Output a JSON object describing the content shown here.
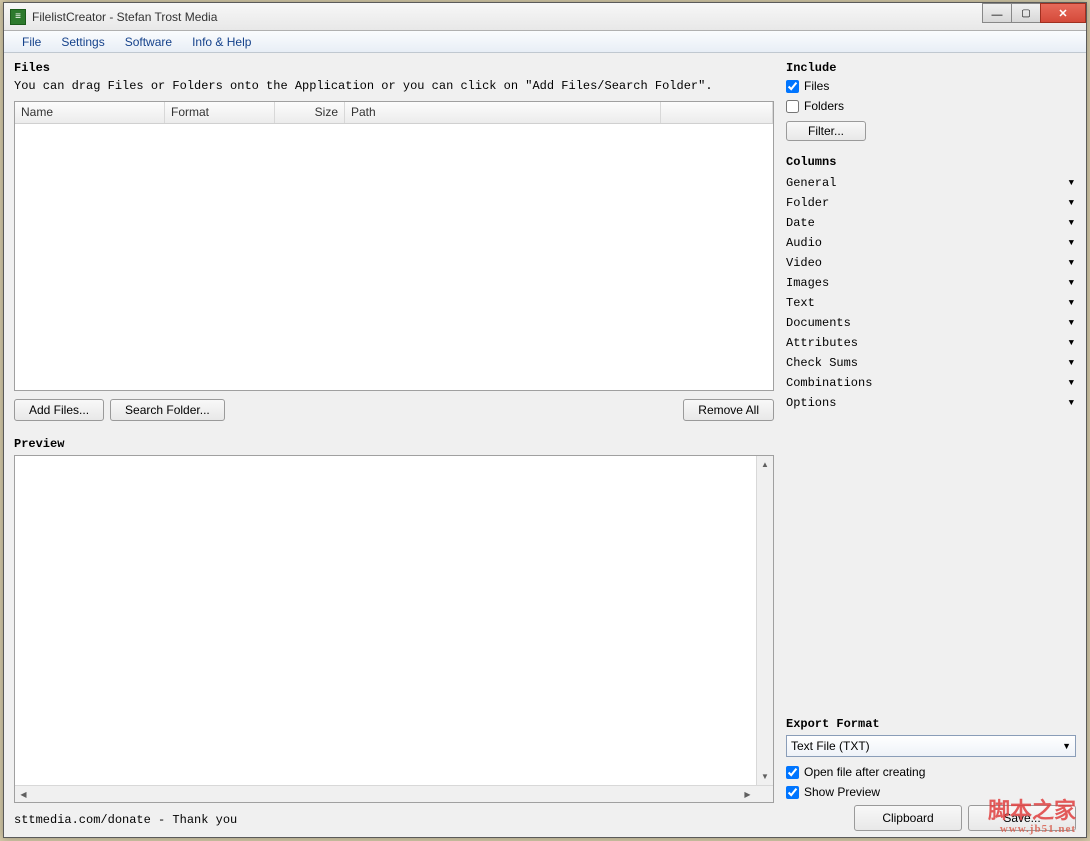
{
  "titlebar": {
    "text": "FilelistCreator - Stefan Trost Media"
  },
  "menu": {
    "items": [
      "File",
      "Settings",
      "Software",
      "Info & Help"
    ]
  },
  "files": {
    "title": "Files",
    "hint": "You can drag Files or Folders onto the Application or you can click on \"Add Files/Search Folder\".",
    "columns": {
      "name": "Name",
      "format": "Format",
      "size": "Size",
      "path": "Path"
    },
    "buttons": {
      "add": "Add Files...",
      "search": "Search Folder...",
      "remove": "Remove All"
    }
  },
  "preview": {
    "title": "Preview"
  },
  "footer": {
    "text": "sttmedia.com/donate - Thank you"
  },
  "include": {
    "title": "Include",
    "files_label": "Files",
    "files_checked": true,
    "folders_label": "Folders",
    "folders_checked": false,
    "filter": "Filter..."
  },
  "columns_panel": {
    "title": "Columns",
    "items": [
      "General",
      "Folder",
      "Date",
      "Audio",
      "Video",
      "Images",
      "Text",
      "Documents",
      "Attributes",
      "Check Sums",
      "Combinations",
      "Options"
    ]
  },
  "export": {
    "title": "Export Format",
    "selected": "Text File (TXT)",
    "open_label": "Open file after creating",
    "open_checked": true,
    "preview_label": "Show Preview",
    "preview_checked": true,
    "clipboard": "Clipboard",
    "save": "Save..."
  },
  "watermark": {
    "main": "脚本之家",
    "sub": "www.jb51.net"
  }
}
